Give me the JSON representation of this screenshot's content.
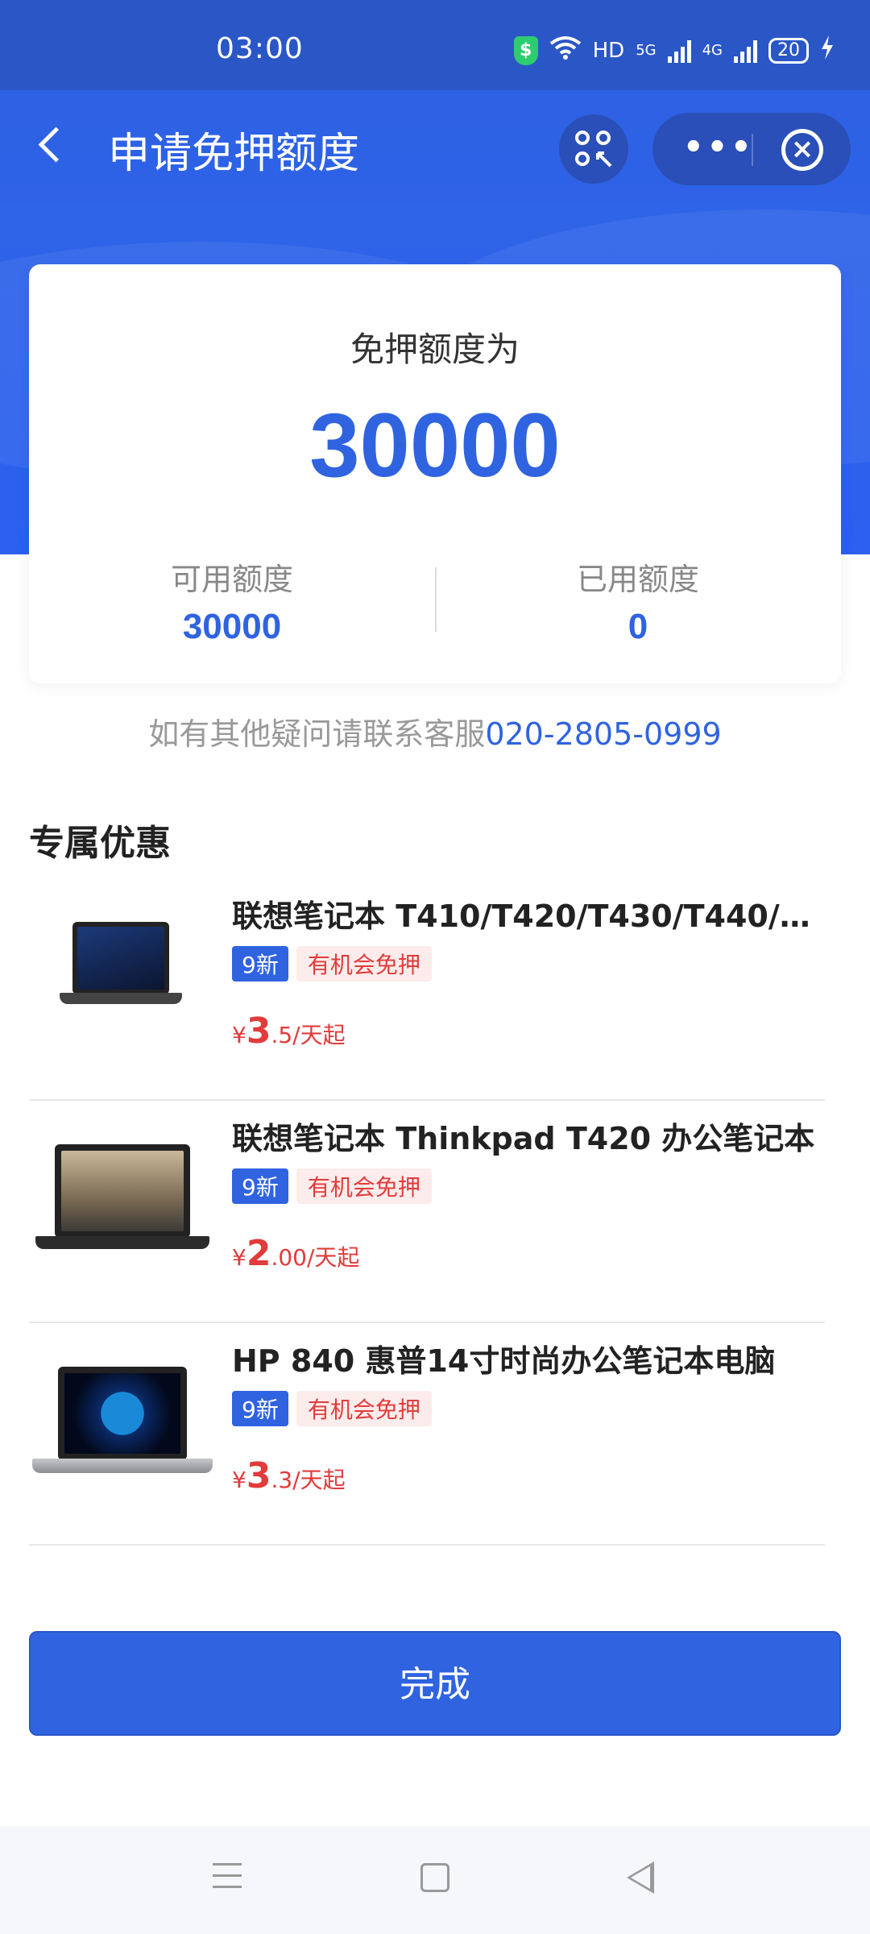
{
  "status_bar": {
    "time": "03:00",
    "network_label": "HD",
    "signal_1": "5G",
    "signal_2": "4G",
    "battery": "20"
  },
  "nav": {
    "title": "申请免押额度"
  },
  "quota": {
    "label": "免押额度为",
    "value": "30000",
    "available_label": "可用额度",
    "available_value": "30000",
    "used_label": "已用额度",
    "used_value": "0"
  },
  "contact": {
    "text": "如有其他疑问请联系客服",
    "phone": "020-2805-0999"
  },
  "section": {
    "title": "专属优惠"
  },
  "products": [
    {
      "name": "联想笔记本 T410/T420/T430/T440/T4...",
      "tag_condition": "9新",
      "tag_deposit": "有机会免押",
      "currency": "¥",
      "price_int": "3",
      "price_rest": ".5/天起"
    },
    {
      "name": "联想笔记本 Thinkpad T420 办公笔记本",
      "tag_condition": "9新",
      "tag_deposit": "有机会免押",
      "currency": "¥",
      "price_int": "2",
      "price_rest": ".00/天起"
    },
    {
      "name": "HP 840 惠普14寸时尚办公笔记本电脑",
      "tag_condition": "9新",
      "tag_deposit": "有机会免押",
      "currency": "¥",
      "price_int": "3",
      "price_rest": ".3/天起"
    }
  ],
  "actions": {
    "done_label": "完成"
  },
  "colors": {
    "primary": "#2f63e0",
    "header": "#2a56c6",
    "price": "#e23b3b",
    "tag_bg": "#fdecec"
  }
}
